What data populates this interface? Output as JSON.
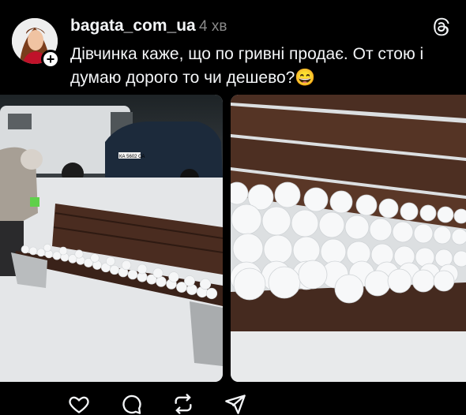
{
  "post": {
    "username": "bagata_com_ua",
    "time": "4 хв",
    "text": "Дівчинка каже, що по гривні продає. От стою і думаю дорого то чи дешево?😄",
    "follow_symbol": "+"
  },
  "icons": {
    "menu": "threads-logo-icon",
    "like": "heart-icon",
    "comment": "comment-icon",
    "repost": "repost-icon",
    "share": "send-icon"
  },
  "images": [
    {
      "name": "bench-snowballs-photo"
    },
    {
      "name": "snowballs-closeup-photo"
    }
  ],
  "photo_details": {
    "plate": "КА 5602 СА"
  }
}
